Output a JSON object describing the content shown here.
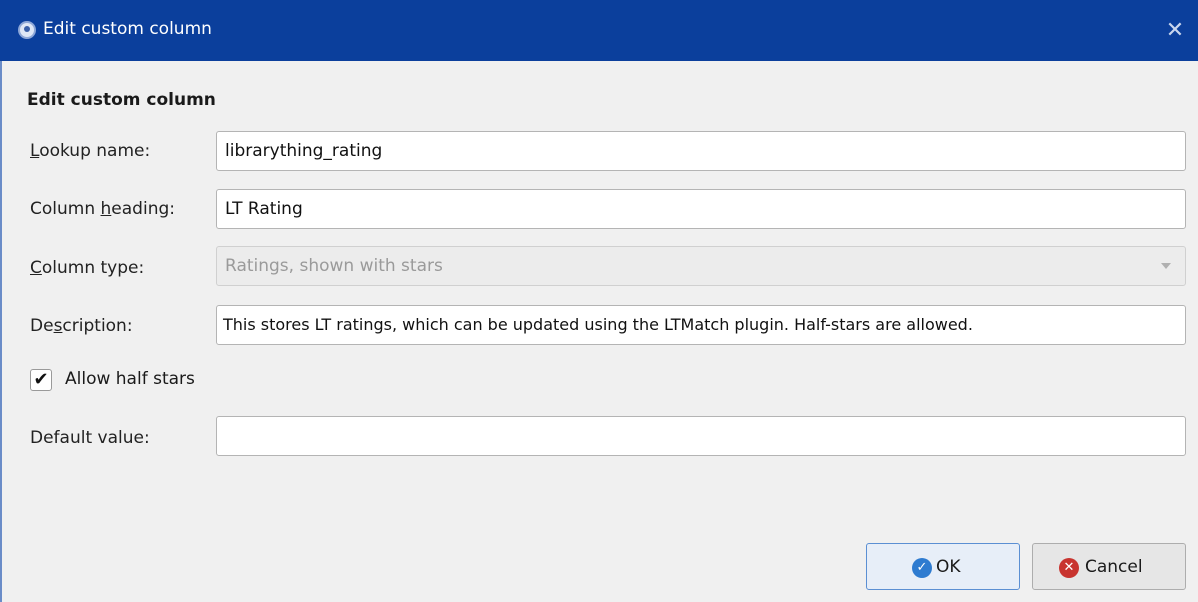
{
  "window": {
    "title": "Edit custom column",
    "close_glyph": "✕",
    "app_icon": "calibre-app-icon"
  },
  "form": {
    "heading": "Edit custom column",
    "lookup_name": {
      "label_prefix": "",
      "label_mnemonic": "L",
      "label_suffix": "ookup name:",
      "value": "librarything_rating"
    },
    "column_heading": {
      "label_prefix": "Column ",
      "label_mnemonic": "h",
      "label_suffix": "eading:",
      "value": "LT Rating"
    },
    "column_type": {
      "label_prefix": "",
      "label_mnemonic": "C",
      "label_suffix": "olumn type:",
      "value": "Ratings, shown with stars",
      "disabled": true
    },
    "description": {
      "label_prefix": "De",
      "label_mnemonic": "s",
      "label_suffix": "cription:",
      "value": "This stores LT ratings, which can be updated using the LTMatch plugin. Half-stars are allowed."
    },
    "allow_half_stars": {
      "label": "Allow half stars",
      "checked": true,
      "check_glyph": "✔"
    },
    "default_value": {
      "label": "Default value:",
      "value": ""
    }
  },
  "buttons": {
    "ok": {
      "label": "OK",
      "icon": "ok-check-icon",
      "icon_glyph": "✓"
    },
    "cancel": {
      "label": "Cancel",
      "icon": "cancel-x-icon",
      "icon_glyph": "✕"
    }
  },
  "colors": {
    "titlebar": "#0b3f9c",
    "ok_icon": "#2e7bd0",
    "cancel_icon": "#c8342f"
  }
}
